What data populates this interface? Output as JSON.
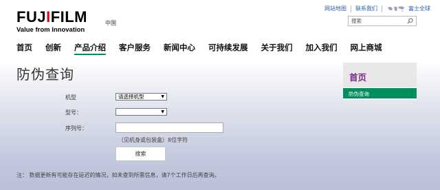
{
  "header": {
    "logo_main_left": "FUJ",
    "logo_dot": "I",
    "logo_main_right": "FILM",
    "logo_tagline": "Value from Innovation",
    "region": "中国",
    "links": [
      "网站地图",
      "联系我们"
    ],
    "global": "富士全球",
    "search_placeholder": "搜索"
  },
  "nav": {
    "items": [
      "首页",
      "创新",
      "产品介绍",
      "客户服务",
      "新闻中心",
      "可持续发展",
      "关于我们",
      "加入我们",
      "网上商城"
    ],
    "active_index": 2
  },
  "page_title": "防伪查询",
  "form": {
    "model_label": "机型",
    "model_value": "请选择机型",
    "type_label": "型号：",
    "type_value": "",
    "serial_label": "序列号：",
    "serial_value": "",
    "hint": "（见机身或包装盒）8位字符",
    "submit": "搜索"
  },
  "note": "注：  数据更新有可能存在延迟的情况，如未查到所需信息，请7个工作日后再查询。",
  "sidebar": {
    "title": "首页",
    "item": "防伪查询"
  },
  "colors": {
    "accent_green": "#008e5c",
    "sidebar_purple": "#7a2a8c",
    "logo_red": "#e60012",
    "link_blue": "#2a5fa8"
  }
}
